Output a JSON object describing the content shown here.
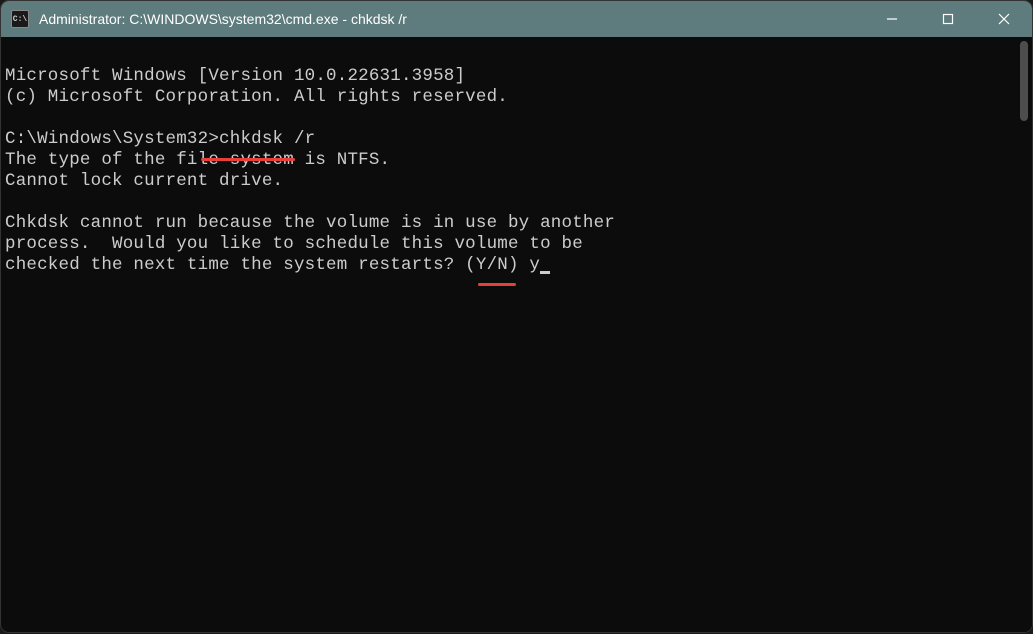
{
  "titlebar": {
    "icon_text": "C:\\",
    "title": "Administrator: C:\\WINDOWS\\system32\\cmd.exe - chkdsk  /r"
  },
  "terminal": {
    "line1": "Microsoft Windows [Version 10.0.22631.3958]",
    "line2": "(c) Microsoft Corporation. All rights reserved.",
    "blank1": "",
    "line3a": "C:\\Windows\\System32>",
    "line3b": "chkdsk /r",
    "line4": "The type of the file system is NTFS.",
    "line5": "Cannot lock current drive.",
    "blank2": "",
    "line6": "Chkdsk cannot run because the volume is in use by another",
    "line7": "process.  Would you like to schedule this volume to be",
    "line8": "checked the next time the system restarts? (Y/N) ",
    "input": "y"
  }
}
